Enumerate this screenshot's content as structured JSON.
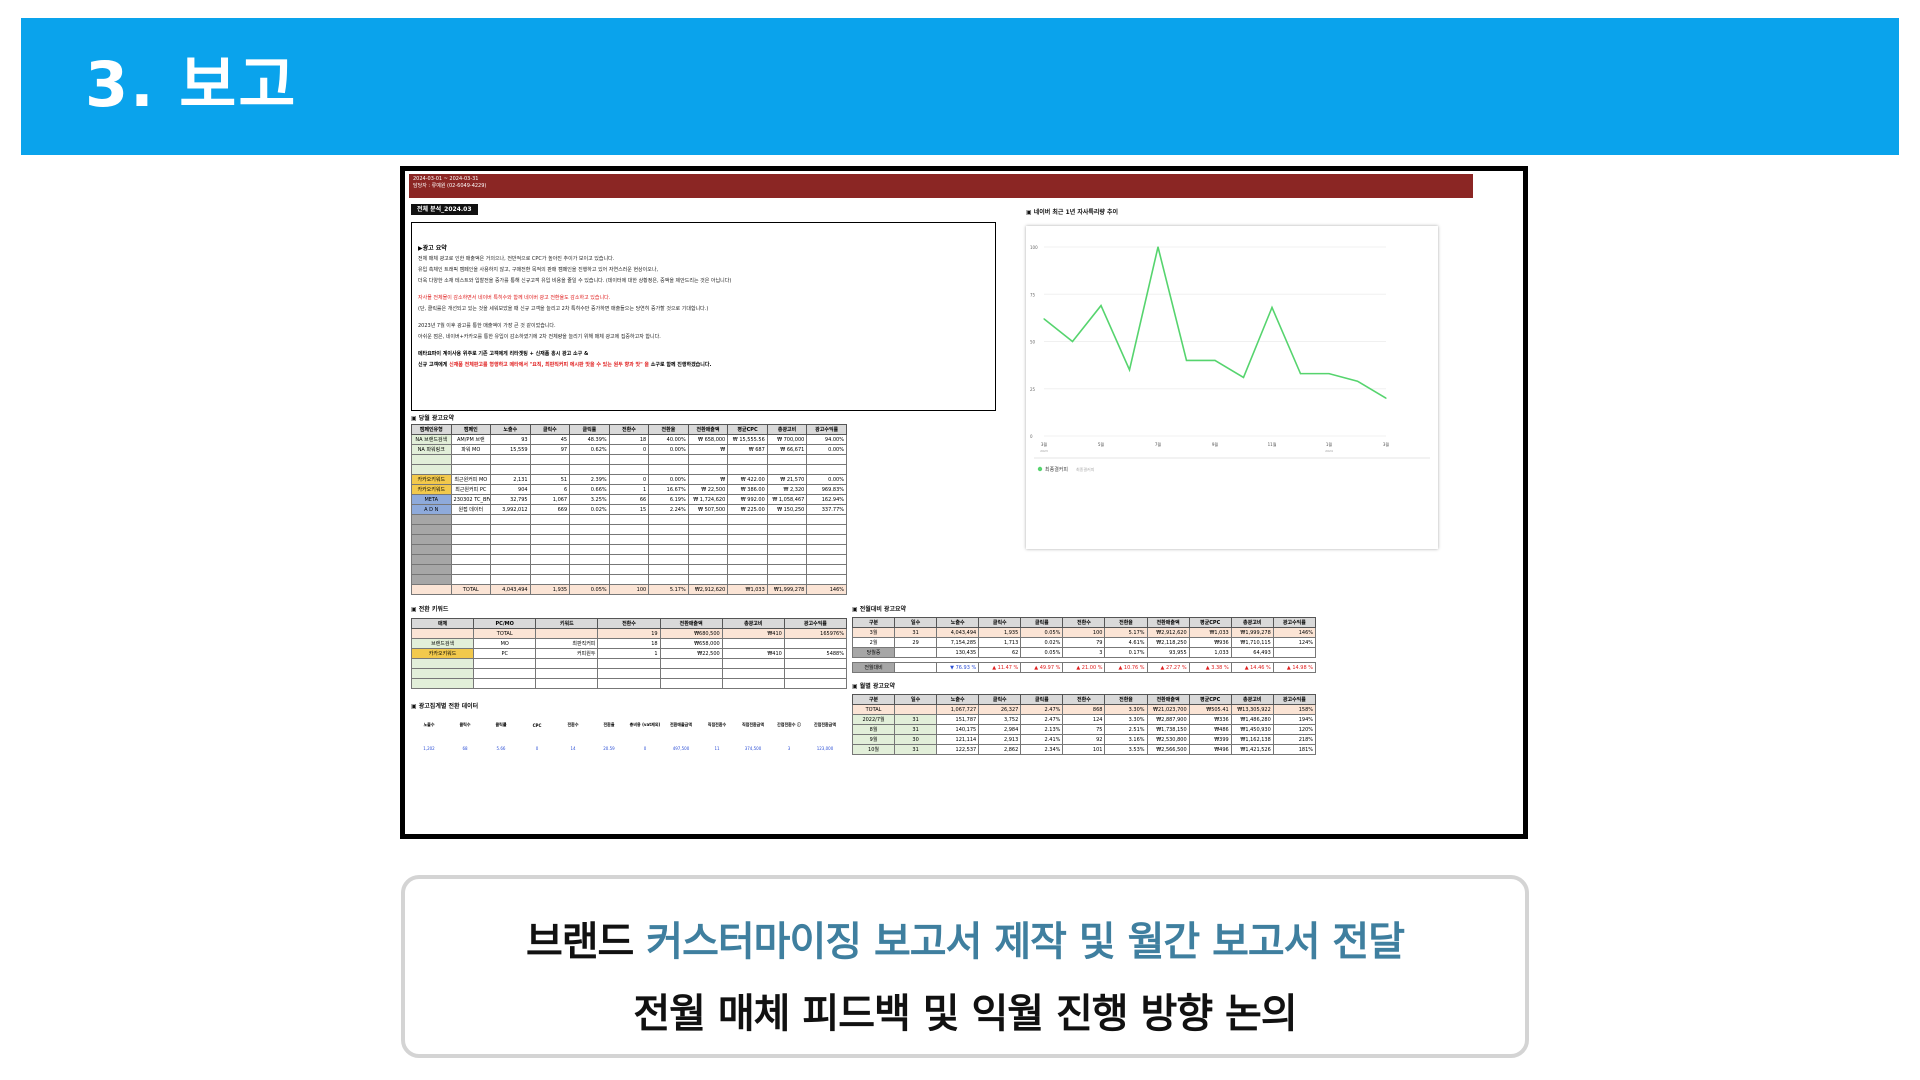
{
  "slide": {
    "title": "3. 보고"
  },
  "report": {
    "topbar": {
      "line1": "2024-03-01 ~ 2024-03-31",
      "line2": "담당자 : 류예원 (02-6049-4229)"
    },
    "section_overall": "전체 분석_2024.03",
    "summary": {
      "heading": "▶광고 요약",
      "para1": [
        "전체 매체 광고로 인한 매출액은 거의으나, 전반적으로 CPC가 높아진 추이가 보이고 있습니다.",
        "유입 측체인 트래픽 캠페인을 사용하지 않고, 구매전환 목적의 판매 캠페인을 진행하고 있어 자연스러운 현상이오나,",
        "더욱 다양한 소재 테스트와 입찰전을 증가를 통해 신규고객 유입 비용을 줄일 수 있습니다. (데이터에 대한 상황정은, 중액을 제안드리는 것은 아닙니다)"
      ],
      "para2_red": "자사몰 전체몰이 감소하면서 네이버 특히수와 함께 네이버 광고 전환율도 감소하고 있습니다.",
      "para2": "(단, 클릭률은 개선되고 있는 것을 세워보았을 때 신규 고객을 늘리고 2차 특히수만 증가하면 매출들으는 당연히 증가할 것으로 기대합니다.)",
      "para3": [
        "2023년 7월 이후 광고를 통한 매출액이 가장 큰 것 같이었습니다.",
        "아쉬운 점은, 네이버+카카오를 통한 유입이 감소하였기에 2차 전체량을 늘리기 위해 매체 광고에 집중하고자 합니다."
      ],
      "bold1": "메타요파이 계이사용 위주로 기존 고객에게 리타겟팅 + 신재품 홍시 광고 소구 &",
      "bold2_a": "신규 고객에게 ",
      "bold2_red": "신재품 전체판고를 형행하고 메타에서 \"요직, 최판직커피 에시판 맛을 수 있는 원두 향과 맛\" 을",
      "bold2_b": " 소구로 함께 진행하겠습니다."
    },
    "chart_label": "네이버 최근 1년 자사특리량 추이",
    "section_monthly": "당월 광고요약",
    "section_conv": "전환 키워드",
    "section_prev": "전월대비 광고요약",
    "section_hist": "월별 광고요약",
    "section_extra": "광고집계별 전환 데이터",
    "monthly_headers": [
      "캠페인유형",
      "캠페인",
      "노출수",
      "클릭수",
      "클릭률",
      "전환수",
      "전환율",
      "전환매출액",
      "평균CPC",
      "총광고비",
      "광고수익률"
    ],
    "monthly_rows": [
      [
        "NA 브랜드검색",
        "AM/PM 브랜",
        "93",
        "45",
        "48.39%",
        "18",
        "40.00%",
        "₩ 658,000",
        "₩ 15,555.56",
        "₩ 700,000",
        "94.00%"
      ],
      [
        "NA 파워링크",
        "파워 MO",
        "15,559",
        "97",
        "0.62%",
        "0",
        "0.00%",
        "₩",
        "₩ 687",
        "₩ 66,671",
        "0.00%"
      ],
      [
        "",
        "",
        "",
        "",
        "",
        "",
        "",
        "",
        "",
        "",
        ""
      ],
      [
        "",
        "",
        "",
        "",
        "",
        "",
        "",
        "",
        "",
        "",
        ""
      ],
      [
        "카카오키워드",
        "최근원커피 MO",
        "2,131",
        "51",
        "2.39%",
        "0",
        "0.00%",
        "₩",
        "₩ 422.00",
        "₩ 21,570",
        "0.00%"
      ],
      [
        "카카오키워드",
        "최근원커피 PC",
        "904",
        "6",
        "0.66%",
        "1",
        "16.67%",
        "₩ 22,500",
        "₩ 386.00",
        "₩ 2,320",
        "969.83%"
      ],
      [
        "META",
        "230302 TC_BFAI",
        "32,795",
        "1,067",
        "3.25%",
        "66",
        "6.19%",
        "₩ 1,724,620",
        "₩ 992.00",
        "₩ 1,058,467",
        "162.94%"
      ],
      [
        "A D N",
        "원접 데이터",
        "3,992,012",
        "669",
        "0.02%",
        "15",
        "2.24%",
        "₩ 507,500",
        "₩ 225.00",
        "₩ 150,250",
        "337.77%"
      ]
    ],
    "monthly_total": [
      "",
      "TOTAL",
      "4,043,494",
      "1,935",
      "0.05%",
      "100",
      "5.17%",
      "₩2,912,620",
      "₩1,033",
      "₩1,999,278",
      "146%"
    ],
    "conv_headers": [
      "매체",
      "PC/MO",
      "키워드",
      "전환수",
      "전환매출액",
      "총광고비",
      "광고수익률"
    ],
    "conv_rows": [
      [
        "",
        "TOTAL",
        "",
        "19",
        "₩680,500",
        "₩410",
        "165976%"
      ],
      [
        "브랜드검색",
        "MO",
        "최판직커피",
        "18",
        "₩658,000",
        "",
        ""
      ],
      [
        "카카오키워드",
        "PC",
        "커피원두",
        "1",
        "₩22,500",
        "₩410",
        "5488%"
      ]
    ],
    "extra_headers": [
      "노출수",
      "클릭수",
      "클릭률",
      "CPC",
      "전환수",
      "전환율",
      "총비용 (vat제외)",
      "전환매출금액",
      "직접전환수",
      "직접전환금액",
      "간접전환수 ⓘ",
      "간접전환금액"
    ],
    "extra_values": [
      "1,202",
      "68",
      "5.66",
      "0",
      "14",
      "20.59",
      "0",
      "497,500",
      "11",
      "374,500",
      "3",
      "123,000"
    ],
    "prev_headers": [
      "구분",
      "일수",
      "노출수",
      "클릭수",
      "클릭률",
      "전환수",
      "전환율",
      "전환매출액",
      "평균CPC",
      "총광고비",
      "광고수익률"
    ],
    "prev_rows": [
      [
        "3월",
        "31",
        "4,043,494",
        "1,935",
        "0.05%",
        "100",
        "5.17%",
        "₩2,912,620",
        "₩1,033",
        "₩1,999,278",
        "146%"
      ],
      [
        "2월",
        "29",
        "7,154,285",
        "1,713",
        "0.02%",
        "79",
        "4.61%",
        "₩2,118,250",
        "₩936",
        "₩1,710,115",
        "124%"
      ],
      [
        "당월증",
        "",
        "130,435",
        "62",
        "0.05%",
        "3",
        "0.17%",
        "93,955",
        "1,033",
        "64,493",
        ""
      ]
    ],
    "prev_delta": [
      "전월대비",
      "",
      "▼ 76.93 %",
      "▲ 11.47 %",
      "▲ 49.97 %",
      "▲ 21.00 %",
      "▲ 10.76 %",
      "▲ 27.27 %",
      "▲ 3.38 %",
      "▲ 14.46 %",
      "▲ 14.98 %"
    ],
    "hist_headers": [
      "구분",
      "일수",
      "노출수",
      "클릭수",
      "클릭률",
      "전환수",
      "전환율",
      "전환매출액",
      "평균CPC",
      "총광고비",
      "광고수익률"
    ],
    "hist_rows": [
      [
        "TOTAL",
        "",
        "1,067,727",
        "26,327",
        "2.47%",
        "868",
        "3.30%",
        "₩21,023,700",
        "₩505.41",
        "₩13,305,922",
        "158%"
      ],
      [
        "2022/7월",
        "31",
        "151,787",
        "3,752",
        "2.47%",
        "124",
        "3.30%",
        "₩2,887,900",
        "₩336",
        "₩1,486,280",
        "194%"
      ],
      [
        "8월",
        "31",
        "140,175",
        "2,984",
        "2.13%",
        "75",
        "2.51%",
        "₩1,738,150",
        "₩486",
        "₩1,450,930",
        "120%"
      ],
      [
        "9월",
        "30",
        "121,114",
        "2,913",
        "2.41%",
        "92",
        "3.16%",
        "₩2,530,800",
        "₩399",
        "₩1,162,138",
        "218%"
      ],
      [
        "10월",
        "31",
        "122,537",
        "2,862",
        "2.34%",
        "101",
        "3.53%",
        "₩2,566,500",
        "₩496",
        "₩1,421,526",
        "181%"
      ]
    ]
  },
  "chart_data": {
    "type": "line",
    "x": [
      "3월",
      "5월",
      "7월",
      "9월",
      "11월",
      "1월",
      "3월"
    ],
    "values": [
      62,
      50,
      69,
      35,
      100,
      40,
      40,
      31,
      68,
      33,
      33,
      29,
      20
    ],
    "ylim": [
      0,
      100
    ],
    "yticks": [
      "100",
      "75",
      "50",
      "25",
      "0"
    ],
    "year_labels": [
      "2023",
      "2024"
    ],
    "legend": "최종결커피",
    "legend_sub": "최종결커피",
    "color": "#56d46e"
  },
  "caption": {
    "line1_a": "브랜드 ",
    "line1_accent": "커스터마이징 보고서 제작 및 월간 보고서 전달",
    "line2": "전월 매체 피드백 및 익월 진행 방향 논의"
  }
}
